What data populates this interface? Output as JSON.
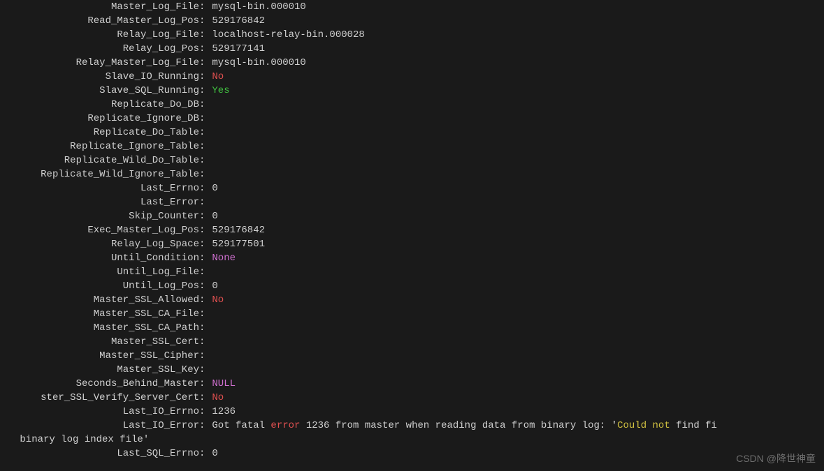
{
  "status": {
    "Master_Log_File": "mysql-bin.000010",
    "Read_Master_Log_Pos": "529176842",
    "Relay_Log_File": "localhost-relay-bin.000028",
    "Relay_Log_Pos": "529177141",
    "Relay_Master_Log_File": "mysql-bin.000010",
    "Slave_IO_Running": "No",
    "Slave_SQL_Running": "Yes",
    "Replicate_Do_DB": "",
    "Replicate_Ignore_DB": "",
    "Replicate_Do_Table": "",
    "Replicate_Ignore_Table": "",
    "Replicate_Wild_Do_Table": "",
    "Replicate_Wild_Ignore_Table": "",
    "Last_Errno": "0",
    "Last_Error": "",
    "Skip_Counter": "0",
    "Exec_Master_Log_Pos": "529176842",
    "Relay_Log_Space": "529177501",
    "Until_Condition": "None",
    "Until_Log_File": "",
    "Until_Log_Pos": "0",
    "Master_SSL_Allowed": "No",
    "Master_SSL_CA_File": "",
    "Master_SSL_CA_Path": "",
    "Master_SSL_Cert": "",
    "Master_SSL_Cipher": "",
    "Master_SSL_Key": "",
    "Seconds_Behind_Master": "NULL",
    "Master_SSL_Verify_Server_Cert": "No",
    "Last_IO_Errno": "1236",
    "Last_SQL_Errno": "0"
  },
  "truncated_labels": {
    "wild_ignore": "Replicate_Wild_Ignore_Table",
    "ssl_verify": "ster_SSL_Verify_Server_Cert"
  },
  "last_io_error": {
    "label": "Last_IO_Error",
    "pre": "Got fatal ",
    "err_word": "error",
    "mid": " 1236 from master when reading data from binary log: '",
    "yellow1": "Could not",
    "mid2": " find fi",
    "wrap": " binary log index file'"
  },
  "watermark": "CSDN @降世神童"
}
